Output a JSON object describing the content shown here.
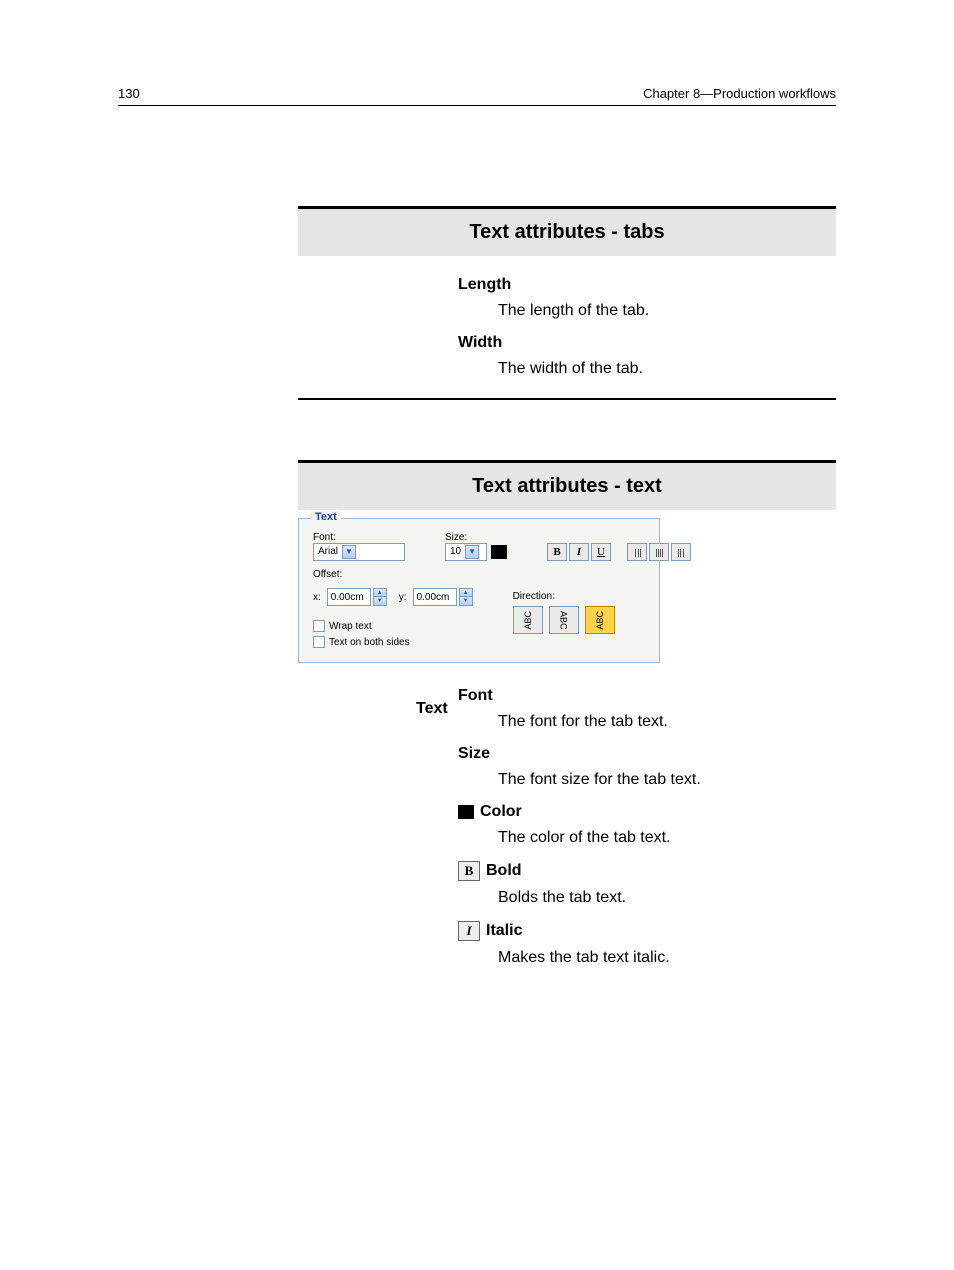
{
  "header": {
    "page_number": "130",
    "chapter": "Chapter 8—Production workflows"
  },
  "topics": [
    {
      "title": "Text attributes - tabs",
      "fields": [
        {
          "term": "Length",
          "desc": "The length of the tab."
        },
        {
          "term": "Width",
          "desc": "The width of the tab."
        }
      ]
    },
    {
      "title": "Text attributes - text",
      "side_label": "Text",
      "panel": {
        "legend": "Text",
        "font_label": "Font:",
        "font_value": "Arial",
        "size_label": "Size:",
        "size_value": "10",
        "offset_label": "Offset:",
        "offset_x_label": "x:",
        "offset_x_value": "0.00cm",
        "offset_y_label": "y:",
        "offset_y_value": "0.00cm",
        "wrap_label": "Wrap text",
        "bothsides_label": "Text on both sides",
        "direction_label": "Direction:",
        "style_b": "B",
        "style_i": "I",
        "style_u": "U",
        "dir_text": "ABC"
      },
      "fields": [
        {
          "term": "Font",
          "desc": "The font for the tab text."
        },
        {
          "term": "Size",
          "desc": "The font size for the tab text."
        },
        {
          "term": "Color",
          "desc": "The color of the tab text.",
          "icon": "color"
        },
        {
          "term": "Bold",
          "desc": "Bolds the tab text.",
          "icon": "bold"
        },
        {
          "term": "Italic",
          "desc": "Makes the tab text italic.",
          "icon": "italic"
        }
      ]
    }
  ]
}
